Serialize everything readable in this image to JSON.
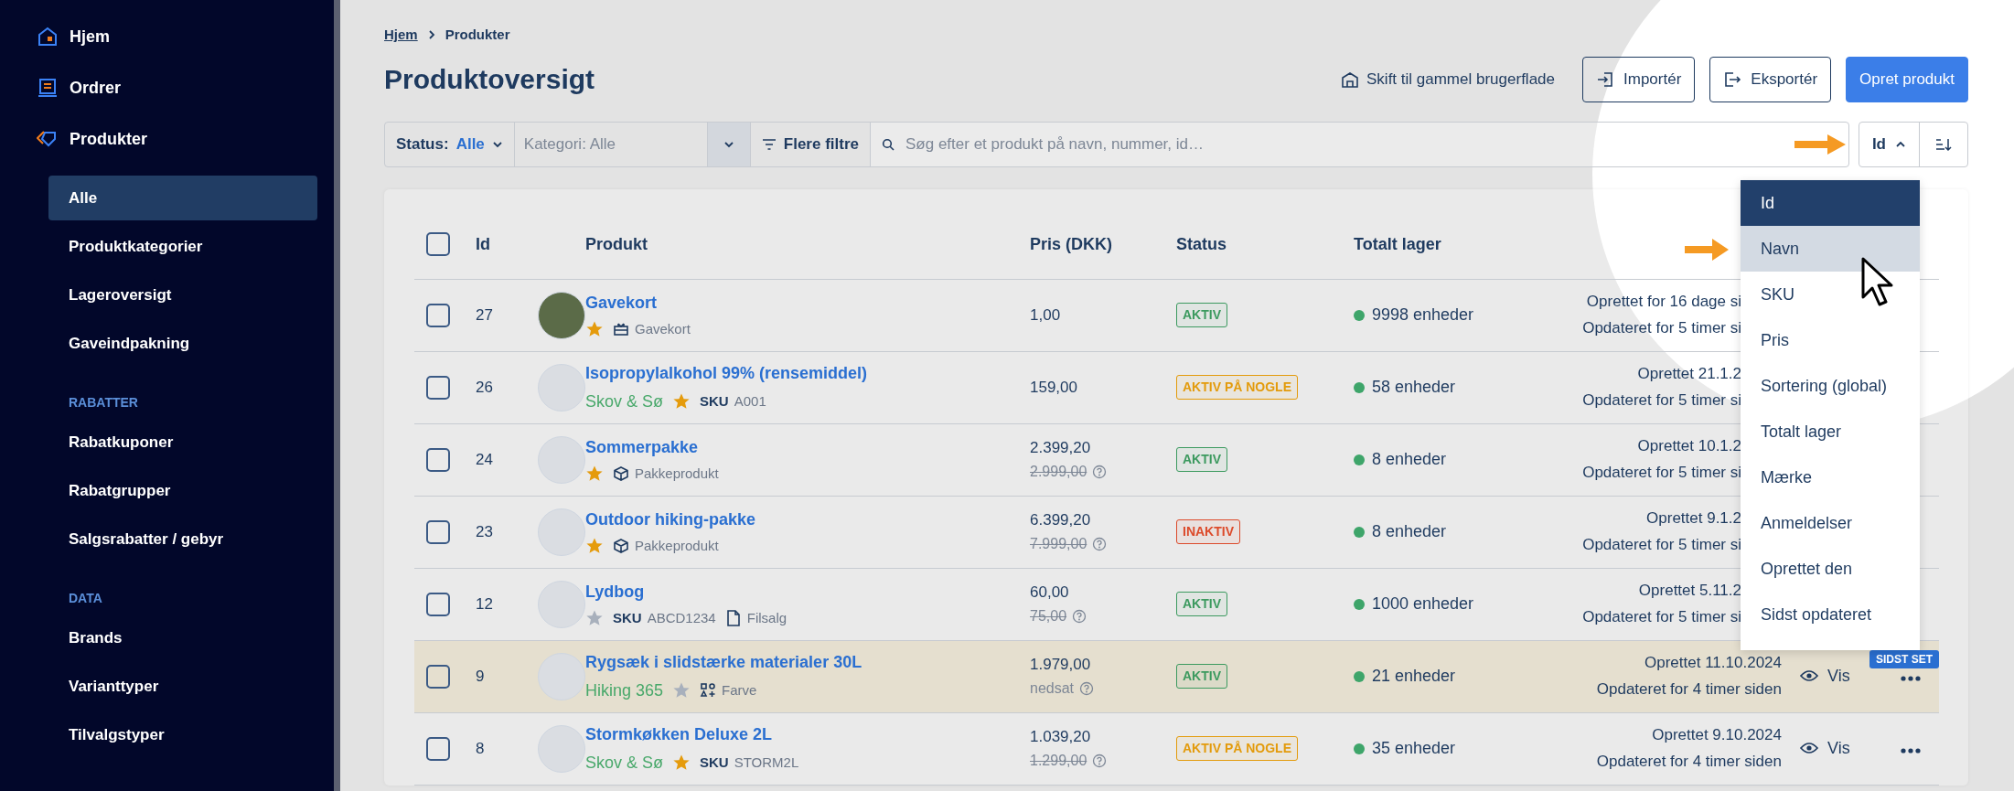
{
  "sidebar": {
    "items": [
      {
        "label": "Hjem"
      },
      {
        "label": "Ordrer"
      },
      {
        "label": "Produkter"
      }
    ],
    "sub_items": [
      {
        "label": "Alle",
        "selected": true
      },
      {
        "label": "Produktkategorier",
        "selected": false
      },
      {
        "label": "Lageroversigt",
        "selected": false
      },
      {
        "label": "Gaveindpakning",
        "selected": false
      }
    ],
    "sections": [
      {
        "heading": "RABATTER",
        "items": [
          {
            "label": "Rabatkuponer",
            "selected": false
          },
          {
            "label": "Rabatgrupper",
            "selected": false
          },
          {
            "label": "Salgsrabatter / gebyr",
            "selected": false
          }
        ]
      },
      {
        "heading": "DATA",
        "items": [
          {
            "label": "Brands",
            "selected": false
          },
          {
            "label": "Varianttyper",
            "selected": false
          },
          {
            "label": "Tilvalgstyper",
            "selected": false
          }
        ]
      }
    ]
  },
  "breadcrumb": [
    "Hjem",
    "Produkter"
  ],
  "title": "Produktoversigt",
  "legacy_link": "Skift til gammel brugerflade",
  "buttons": [
    {
      "label": "Importér",
      "kind": "import"
    },
    {
      "label": "Eksportér",
      "kind": "export"
    },
    {
      "label": "Opret produkt",
      "kind": "primary"
    }
  ],
  "filters": {
    "status_label": "Status:",
    "status_value": "Alle",
    "category_placeholder": "Kategori: Alle",
    "more_filters": "Flere filtre",
    "search_placeholder": "Søg efter et produkt på navn, nummer, id…"
  },
  "sort": {
    "label": "Id",
    "expanded": true,
    "options": [
      {
        "label": "Id",
        "selected": true,
        "hovered": false
      },
      {
        "label": "Navn",
        "selected": false,
        "hovered": true
      },
      {
        "label": "SKU",
        "selected": false,
        "hovered": false
      },
      {
        "label": "Pris",
        "selected": false,
        "hovered": false
      },
      {
        "label": "Sortering (global)",
        "selected": false,
        "hovered": false
      },
      {
        "label": "Totalt lager",
        "selected": false,
        "hovered": false
      },
      {
        "label": "Mærke",
        "selected": false,
        "hovered": false
      },
      {
        "label": "Anmeldelser",
        "selected": false,
        "hovered": false
      },
      {
        "label": "Oprettet den",
        "selected": false,
        "hovered": false
      },
      {
        "label": "Sidst opdateret",
        "selected": false,
        "hovered": false
      }
    ]
  },
  "table": {
    "all_checked": false,
    "columns": [
      "Id",
      "Produkt",
      "Pris (DKK)",
      "Status",
      "Totalt lager"
    ],
    "rows": [
      {
        "checked": false,
        "highlighted": false,
        "id": "27",
        "name": "Gavekort",
        "favorite": true,
        "meta": [
          {
            "kind": "gift",
            "text": "Gavekort"
          }
        ],
        "price": "1,00",
        "status": {
          "label": "AKTIV",
          "kind": "active"
        },
        "stock": "9998 enheder",
        "created": "Oprettet for 16 dage si",
        "updated": "Opdateret for 5 timer si"
      },
      {
        "checked": false,
        "highlighted": false,
        "id": "26",
        "name": "Isopropylalkohol 99% (rensemiddel)",
        "brand": "Skov & Sø",
        "favorite": true,
        "meta": [
          {
            "kind": "sku",
            "text": "**SKU** A001"
          }
        ],
        "price": "159,00",
        "status": {
          "label": "AKTIV PÅ NOGLE",
          "kind": "partial"
        },
        "stock": "58 enheder",
        "created": "Oprettet 21.1.2",
        "updated": "Opdateret for 5 timer si"
      },
      {
        "checked": false,
        "highlighted": false,
        "id": "24",
        "name": "Sommerpakke",
        "favorite": true,
        "meta": [
          {
            "kind": "package",
            "text": "Pakkeprodukt"
          }
        ],
        "price": "2.399,20",
        "old_price": "2.999,00",
        "status": {
          "label": "AKTIV",
          "kind": "active"
        },
        "stock": "8 enheder",
        "created": "Oprettet 10.1.2",
        "updated": "Opdateret for 5 timer si"
      },
      {
        "checked": false,
        "highlighted": false,
        "id": "23",
        "name": "Outdoor hiking-pakke",
        "favorite": true,
        "meta": [
          {
            "kind": "package",
            "text": "Pakkeprodukt"
          }
        ],
        "price": "6.399,20",
        "old_price": "7.999,00",
        "status": {
          "label": "INAKTIV",
          "kind": "inactive"
        },
        "stock": "8 enheder",
        "created": "Oprettet 9.1.2",
        "updated": "Opdateret for 5 timer si"
      },
      {
        "checked": false,
        "highlighted": false,
        "id": "12",
        "name": "Lydbog",
        "favorite": false,
        "meta": [
          {
            "kind": "sku",
            "text": "**SKU** ABCD1234"
          },
          {
            "kind": "file",
            "text": "Filsalg"
          }
        ],
        "price": "60,00",
        "old_price": "75,00",
        "status": {
          "label": "AKTIV",
          "kind": "active"
        },
        "stock": "1000 enheder",
        "created": "Oprettet 5.11.2",
        "updated": "Opdateret for 5 timer si"
      },
      {
        "checked": false,
        "highlighted": true,
        "id": "9",
        "name": "Rygsæk i slidstærke materialer 30L",
        "brand": "Hiking 365",
        "favorite": false,
        "meta": [
          {
            "kind": "variant",
            "text": "Farve"
          }
        ],
        "price": "1.979,00",
        "price_note": "nedsat",
        "status": {
          "label": "AKTIV",
          "kind": "active"
        },
        "stock": "21 enheder",
        "created": "Oprettet 11.10.2024",
        "updated": "Opdateret for 4 timer siden",
        "view": "Vis",
        "badge": "SIDST SET"
      },
      {
        "checked": false,
        "highlighted": false,
        "id": "8",
        "name": "Stormkøkken Deluxe 2L",
        "brand": "Skov & Sø",
        "favorite": true,
        "meta": [
          {
            "kind": "sku",
            "text": "**SKU** STORM2L"
          }
        ],
        "price": "1.039,20",
        "old_price": "1.299,00",
        "status": {
          "label": "AKTIV PÅ NOGLE",
          "kind": "partial"
        },
        "stock": "35 enheder",
        "created": "Oprettet 9.10.2024",
        "updated": "Opdateret for 4 timer siden",
        "view": "Vis"
      }
    ]
  }
}
